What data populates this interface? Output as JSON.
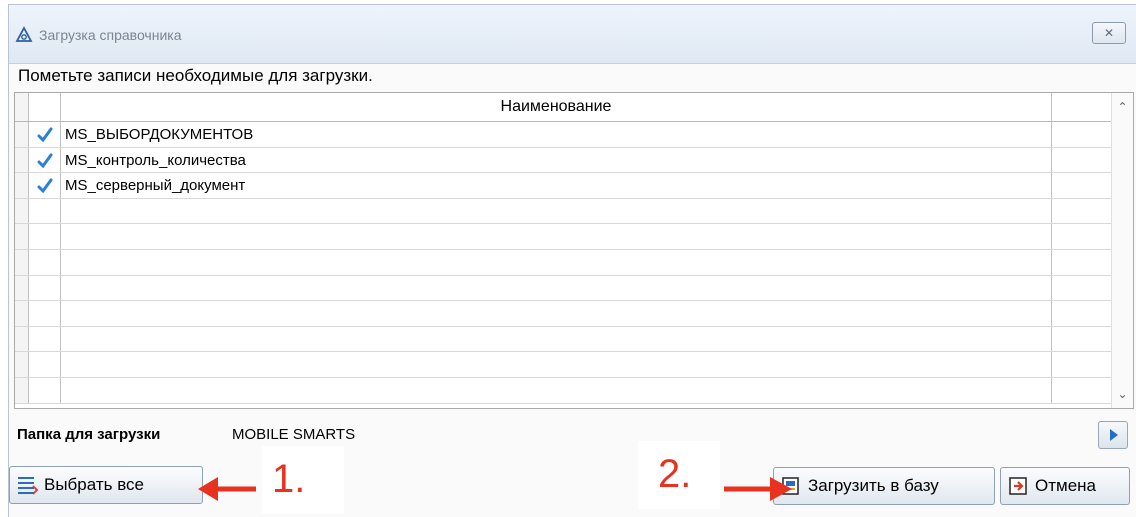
{
  "window": {
    "title": "Загрузка справочника",
    "close_label": "✕"
  },
  "instruction": "Пометьте записи необходимые для загрузки.",
  "grid": {
    "column_header": "Наименование",
    "rows": [
      {
        "name": "MS_ВЫБОРДОКУМЕНТОВ",
        "checked": true
      },
      {
        "name": "MS_контроль_количества",
        "checked": true
      },
      {
        "name": "MS_серверный_документ",
        "checked": true
      },
      {
        "name": "",
        "checked": false
      },
      {
        "name": "",
        "checked": false
      },
      {
        "name": "",
        "checked": false
      },
      {
        "name": "",
        "checked": false
      },
      {
        "name": "",
        "checked": false
      },
      {
        "name": "",
        "checked": false
      },
      {
        "name": "",
        "checked": false
      },
      {
        "name": "",
        "checked": false
      }
    ]
  },
  "folder": {
    "label": "Папка для загрузки",
    "value": "MOBILE SMARTS"
  },
  "buttons": {
    "select_all": "Выбрать все",
    "load_to_db": "Загрузить в базу",
    "cancel": "Отмена"
  },
  "annotations": {
    "step1": "1.",
    "step2": "2.",
    "color": "#e8311f"
  },
  "colors": {
    "check_blue": "#2b7fd6",
    "title_gradient_top": "#eef4fb"
  }
}
